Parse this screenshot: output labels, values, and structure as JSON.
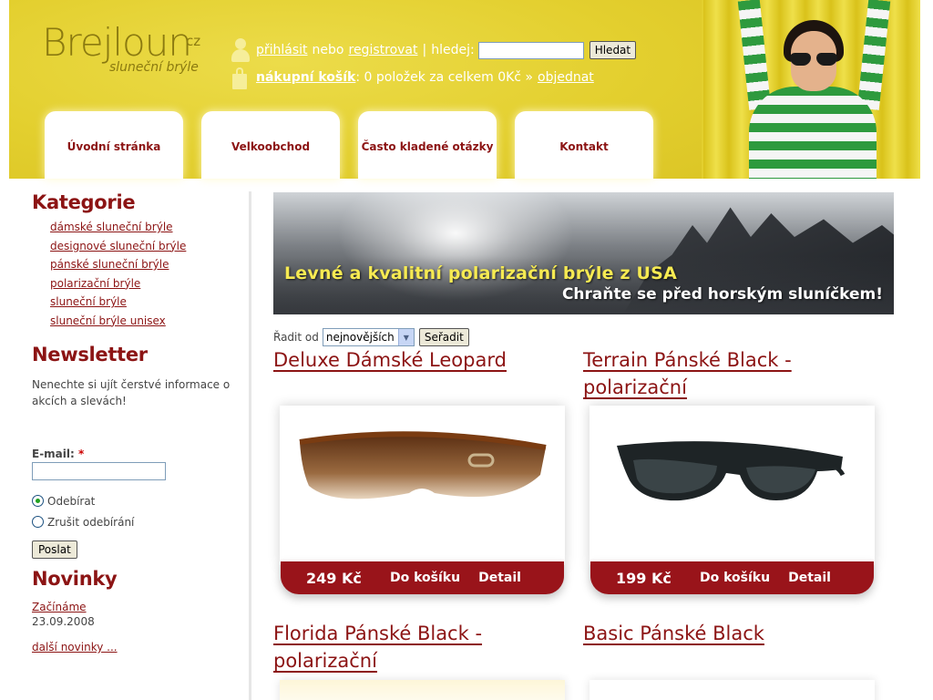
{
  "brand": {
    "logo_main": "Brejloun",
    "logo_tld": "cz",
    "logo_sub": "sluneční brýle"
  },
  "topbar": {
    "login": "přihlásit",
    "or": "nebo",
    "register": "registrovat",
    "pipe": "|",
    "search_label": "hledej:",
    "search_value": "",
    "search_button": "Hledat",
    "cart_label": "nákupní košík",
    "cart_summary": ": 0 položek za celkem 0Kč »",
    "order_link": "objednat"
  },
  "nav": {
    "items": [
      {
        "label": "Úvodní stránka"
      },
      {
        "label": "Velkoobchod"
      },
      {
        "label": "Často kladené otázky"
      },
      {
        "label": "Kontakt"
      }
    ]
  },
  "sidebar": {
    "categories_title": "Kategorie",
    "categories": [
      {
        "label": "dámské sluneční brýle"
      },
      {
        "label": "designové sluneční brýle"
      },
      {
        "label": "pánské sluneční brýle"
      },
      {
        "label": "polarizační brýle"
      },
      {
        "label": "sluneční brýle"
      },
      {
        "label": "sluneční brýle unisex"
      }
    ],
    "newsletter_title": "Newsletter",
    "newsletter_text": "Nenechte si ujít čerstvé informace o akcích a slevách!",
    "email_label": "E-mail:",
    "email_required": "*",
    "email_value": "",
    "radio_subscribe": "Odebírat",
    "radio_unsubscribe": "Zrušit odebírání",
    "subscribe_selected": true,
    "post_button": "Poslat",
    "news_title": "Novinky",
    "news_item": "Začínáme",
    "news_date": "23.09.2008",
    "more_news": "další novinky ..."
  },
  "banner": {
    "line1": "Levné a kvalitní polarizační brýle z USA",
    "line2": "Chraňte se před horským sluníčkem!"
  },
  "sort": {
    "label": "Řadit od",
    "selected": "nejnovějších",
    "button": "Seřadit"
  },
  "products": [
    {
      "title": "Deluxe Dámské Leopard",
      "price": "249 Kč",
      "cart": "Do košíku",
      "detail": "Detail"
    },
    {
      "title": "Terrain Pánské Black - polarizační",
      "price": "199 Kč",
      "cart": "Do košíku",
      "detail": "Detail"
    },
    {
      "title": "Florida Pánské Black - polarizační"
    },
    {
      "title": "Basic Pánské Black"
    }
  ],
  "colors": {
    "header_yellow": "#e3cf2e",
    "accent_red": "#8c1414",
    "bar_red": "#99141a"
  }
}
